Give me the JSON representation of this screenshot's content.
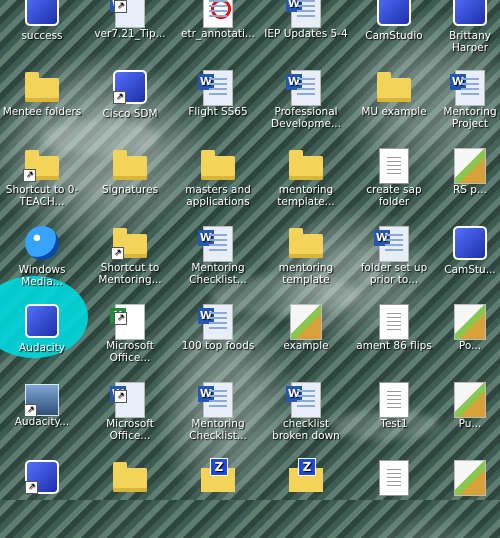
{
  "desktop": {
    "icons": [
      {
        "label": "success",
        "type": "skype"
      },
      {
        "label": "ver7.21_Tip...",
        "type": "doc"
      },
      {
        "label": "etr_annotati...",
        "type": "pdf"
      },
      {
        "label": "IEP Updates 5-4",
        "type": "doc"
      },
      {
        "label": "CamStudio",
        "type": "app"
      },
      {
        "label": "Brittany Harper",
        "type": "app"
      },
      {
        "label": "Mentee folders",
        "type": "folder"
      },
      {
        "label": "Cisco SDM",
        "type": "app"
      },
      {
        "label": "Flight SS65",
        "type": "word"
      },
      {
        "label": "Professional Developme...",
        "type": "word"
      },
      {
        "label": "MU example",
        "type": "folder"
      },
      {
        "label": "Mentoring Project",
        "type": "word"
      },
      {
        "label": "Shortcut to 0-TEACH...",
        "type": "folder"
      },
      {
        "label": "Signatures",
        "type": "folder"
      },
      {
        "label": "masters and applications",
        "type": "folder"
      },
      {
        "label": "mentoring template...",
        "type": "folder"
      },
      {
        "label": "create sap folder",
        "type": "text"
      },
      {
        "label": "RS p...",
        "type": "image"
      },
      {
        "label": "Windows Media...",
        "type": "media"
      },
      {
        "label": "Shortcut to Mentoring...",
        "type": "folder"
      },
      {
        "label": "Mentoring Checklist...",
        "type": "word"
      },
      {
        "label": "mentoring template",
        "type": "folder"
      },
      {
        "label": "folder set up prior to...",
        "type": "word"
      },
      {
        "label": "CamStu...",
        "type": "app"
      },
      {
        "label": "Audacity",
        "type": "audacity"
      },
      {
        "label": "Microsoft Office...",
        "type": "excel"
      },
      {
        "label": "100 top foods",
        "type": "word"
      },
      {
        "label": "example",
        "type": "image"
      },
      {
        "label": "ament 86 flips",
        "type": "text"
      },
      {
        "label": "Po...",
        "type": "image"
      },
      {
        "label": "Audacity...",
        "type": "disk"
      },
      {
        "label": "Microsoft Office...",
        "type": "word"
      },
      {
        "label": "Mentoring Checklist...",
        "type": "word"
      },
      {
        "label": "checklist broken down",
        "type": "word"
      },
      {
        "label": "Test1",
        "type": "text"
      },
      {
        "label": "Pu...",
        "type": "image"
      },
      {
        "label": "",
        "type": "app"
      },
      {
        "label": "",
        "type": "folder"
      },
      {
        "label": "",
        "type": "zip"
      },
      {
        "label": "",
        "type": "zip"
      },
      {
        "label": "",
        "type": "text"
      },
      {
        "label": "",
        "type": "image"
      }
    ]
  }
}
